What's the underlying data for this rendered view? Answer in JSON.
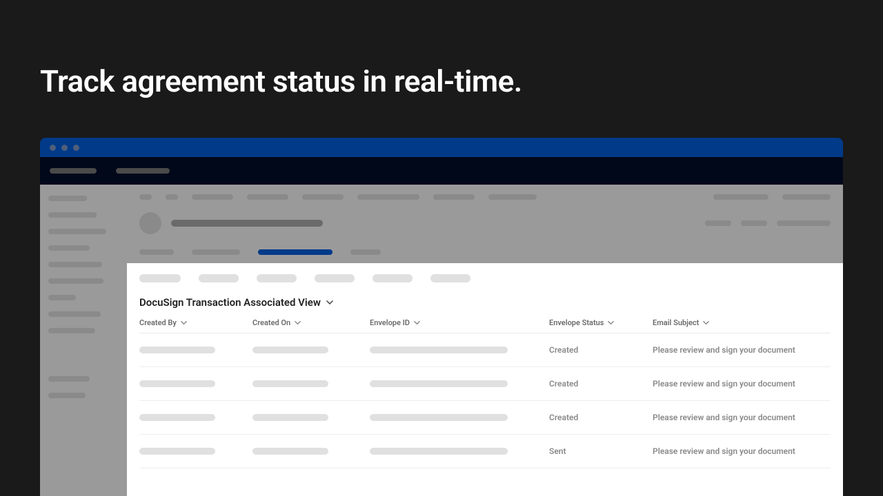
{
  "headline": "Track agreement status in real-time.",
  "view_title": "DocuSign Transaction Associated View",
  "columns": {
    "created_by": "Created By",
    "created_on": "Created On",
    "envelope_id": "Envelope ID",
    "envelope_status": "Envelope Status",
    "email_subject": "Email Subject"
  },
  "rows": [
    {
      "status": "Created",
      "subject": "Please review and sign your document"
    },
    {
      "status": "Created",
      "subject": "Please review and sign your document"
    },
    {
      "status": "Created",
      "subject": "Please review and sign your document"
    },
    {
      "status": "Sent",
      "subject": "Please review and sign your document"
    }
  ]
}
